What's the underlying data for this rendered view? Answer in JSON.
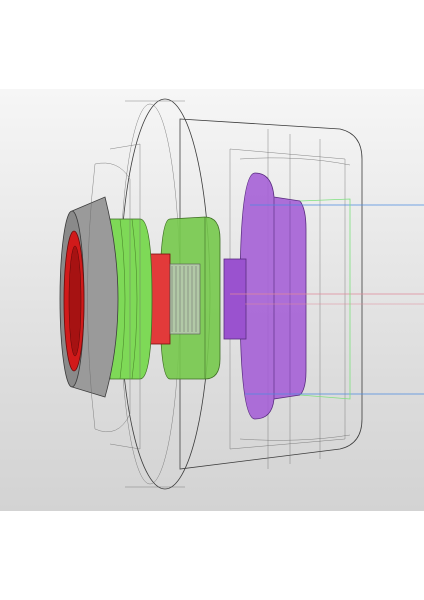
{
  "viewport": {
    "background_top": "#f6f6f6",
    "background_bottom": "#d3d3d3"
  },
  "model": {
    "parts": [
      {
        "name": "front-cone-flange",
        "color": "#9a9a9a"
      },
      {
        "name": "front-bore-ring",
        "color": "#d11a1a"
      },
      {
        "name": "front-ring-band",
        "color": "#7ed957"
      },
      {
        "name": "middle-disc",
        "color": "#75c94b"
      },
      {
        "name": "toothed-ring",
        "color": "#e23a3a"
      },
      {
        "name": "rear-rotor",
        "color": "#a561d6"
      },
      {
        "name": "housing-body",
        "color": "#a9a9a9"
      }
    ],
    "guide_line_colors": [
      "#4b8be0",
      "#e08a9a",
      "#7ee07e"
    ]
  }
}
